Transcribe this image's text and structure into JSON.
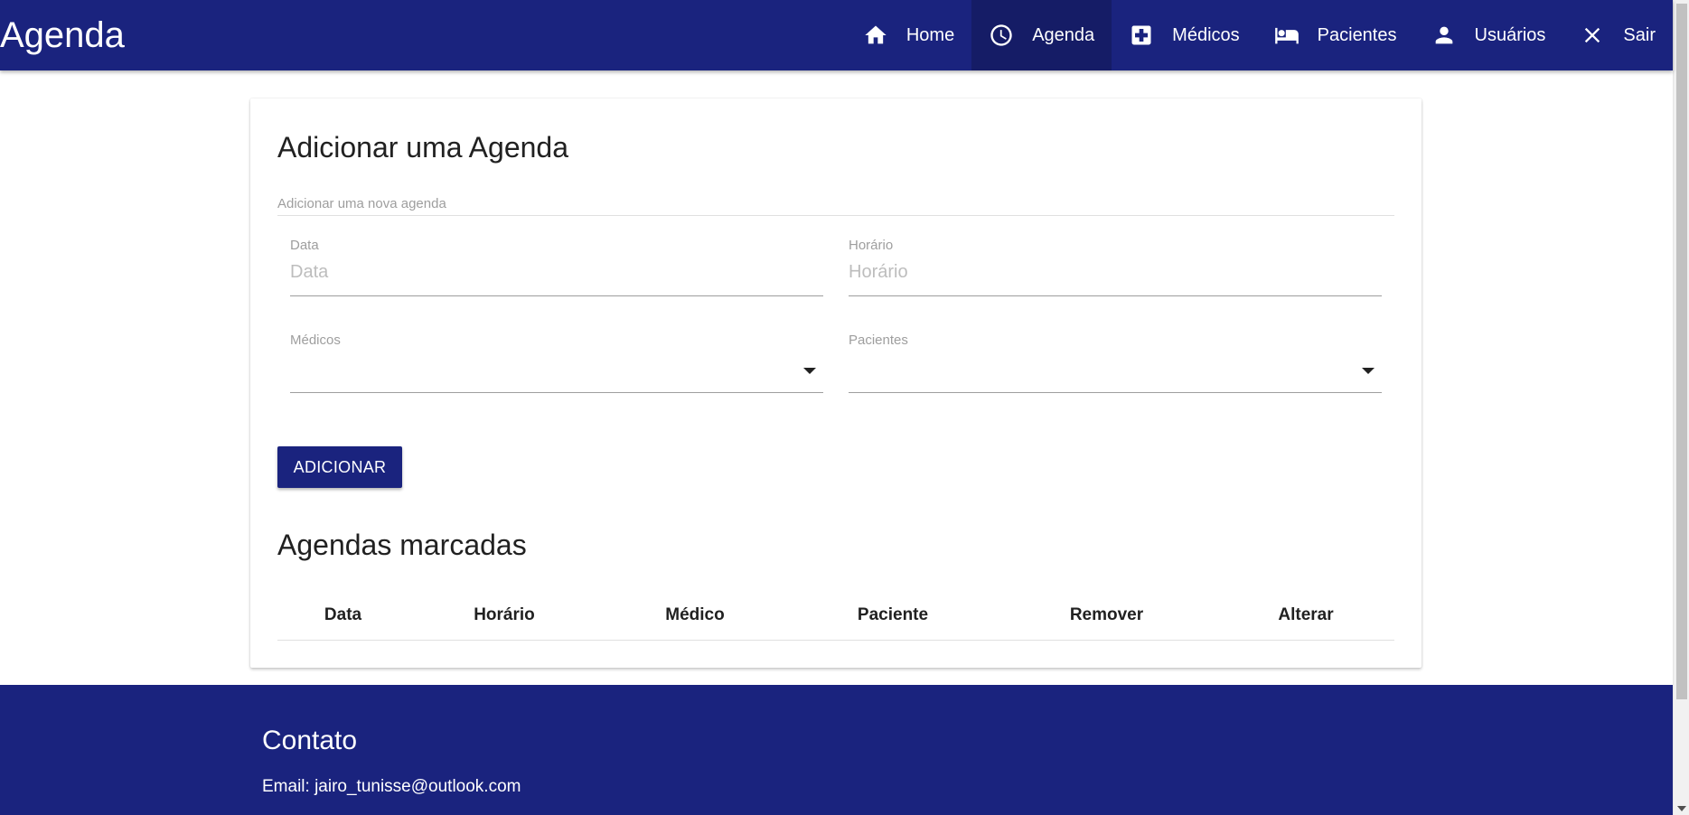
{
  "navbar": {
    "brand": "Agenda",
    "items": [
      {
        "label": "Home",
        "icon": "home-icon"
      },
      {
        "label": "Agenda",
        "icon": "clock-icon",
        "active": true
      },
      {
        "label": "Médicos",
        "icon": "medical-plus-icon"
      },
      {
        "label": "Pacientes",
        "icon": "bed-icon"
      },
      {
        "label": "Usuários",
        "icon": "person-icon"
      },
      {
        "label": "Sair",
        "icon": "close-icon"
      }
    ]
  },
  "form": {
    "title": "Adicionar uma Agenda",
    "subheader": "Adicionar uma nova agenda",
    "data": {
      "label": "Data",
      "placeholder": "Data",
      "value": ""
    },
    "horario": {
      "label": "Horário",
      "placeholder": "Horário",
      "value": ""
    },
    "medicos": {
      "label": "Médicos",
      "value": ""
    },
    "pacientes": {
      "label": "Pacientes",
      "value": ""
    },
    "submit_label": "ADICIONAR"
  },
  "schedule": {
    "title": "Agendas marcadas",
    "columns": [
      "Data",
      "Horário",
      "Médico",
      "Paciente",
      "Remover",
      "Alterar"
    ],
    "rows": []
  },
  "footer": {
    "title": "Contato",
    "email": "Email: jairo_tunisse@outlook.com"
  },
  "colors": {
    "primary": "#1a237e",
    "primary_dark": "#151c66"
  }
}
